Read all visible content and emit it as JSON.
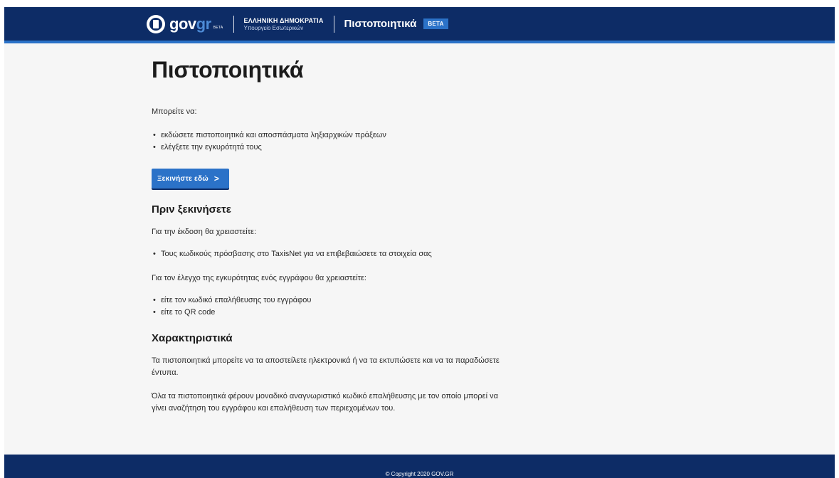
{
  "header": {
    "logo_main": "gov",
    "logo_accent": "gr",
    "logo_beta": "BETA",
    "republic_line1": "ΕΛΛΗΝΙΚΗ ΔΗΜΟΚΡΑΤΙΑ",
    "republic_line2": "Υπουργείο Εσωτερικών",
    "service_title": "Πιστοποιητικά",
    "beta_tag": "BETA"
  },
  "main": {
    "title": "Πιστοποιητικά",
    "intro": "Μπορείτε να:",
    "intro_items": [
      "εκδώσετε πιστοποιητικά και αποσπάσματα ληξιαρχικών πράξεων",
      "ελέγξετε την εγκυρότητά τους"
    ],
    "start_button": "Ξεκινήστε εδώ",
    "start_chevron": ">",
    "before_heading": "Πριν ξεκινήσετε",
    "issue_intro": "Για την έκδοση θα χρειαστείτε:",
    "issue_items": [
      "Τους κωδικούς πρόσβασης στο TaxisNet για να επιβεβαιώσετε τα στοιχεία σας"
    ],
    "verify_intro": "Για τον έλεγχο της εγκυρότητας ενός εγγράφου θα χρειαστείτε:",
    "verify_items": [
      "είτε τον κωδικό επαλήθευσης του εγγράφου",
      "είτε το QR code"
    ],
    "features_heading": "Χαρακτηριστικά",
    "features_p1": "Τα πιστοποιητικά μπορείτε να τα αποστείλετε ηλεκτρονικά ή να τα εκτυπώσετε και να τα παραδώσετε έντυπα.",
    "features_p2": "Όλα τα πιστοποιητικά φέρουν μοναδικό αναγνωριστικό κωδικό επαλήθευσης με τον οποίο μπορεί να γίνει αναζήτηση του εγγράφου και επαλήθευση των περιεχομένων του."
  },
  "footer": {
    "copyright": "© Copyright 2020 GOV.GR"
  },
  "colors": {
    "header_bg": "#0d2c66",
    "accent": "#2b72c8",
    "page_bg": "#f6f6f6"
  }
}
